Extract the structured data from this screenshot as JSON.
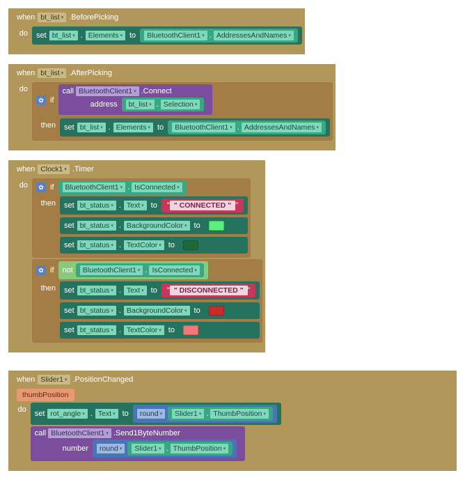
{
  "kw": {
    "when": "when",
    "do": "do",
    "set": "set",
    "to": "to",
    "if": "if",
    "then": "then",
    "call": "call",
    "not": "not"
  },
  "blocks": {
    "beforePicking": {
      "component": "bt_list",
      "event": ".BeforePicking",
      "set": {
        "comp": "bt_list",
        "prop": "Elements",
        "val": {
          "comp": "BluetoothClient1",
          "prop": "AddressesAndNames"
        }
      }
    },
    "afterPicking": {
      "component": "bt_list",
      "event": ".AfterPicking",
      "call": {
        "comp": "BluetoothClient1",
        "method": ".Connect",
        "argName": "address",
        "argVal": {
          "comp": "bt_list",
          "prop": "Selection"
        }
      },
      "thenSet": {
        "comp": "bt_list",
        "prop": "Elements",
        "val": {
          "comp": "BluetoothClient1",
          "prop": "AddressesAndNames"
        }
      }
    },
    "clockTimer": {
      "component": "Clock1",
      "event": ".Timer",
      "ifCond": {
        "comp": "BluetoothClient1",
        "prop": "IsConnected"
      },
      "thenSets": [
        {
          "comp": "bt_status",
          "prop": "Text",
          "string": "\" CONNECTED \""
        },
        {
          "comp": "bt_status",
          "prop": "BackgroundColor",
          "color": "#5af07a"
        },
        {
          "comp": "bt_status",
          "prop": "TextColor",
          "color": "#1e6b3a"
        }
      ],
      "if2Sets": [
        {
          "comp": "bt_status",
          "prop": "Text",
          "string": "\" DISCONNECTED \""
        },
        {
          "comp": "bt_status",
          "prop": "BackgroundColor",
          "color": "#c92a2a"
        },
        {
          "comp": "bt_status",
          "prop": "TextColor",
          "color": "#f07878"
        }
      ]
    },
    "sliderChanged": {
      "component": "Slider1",
      "event": ".PositionChanged",
      "param": "thumbPosition",
      "set": {
        "comp": "rot_angle",
        "prop": "Text",
        "round": "round",
        "val": {
          "comp": "Slider1",
          "prop": "ThumbPosition"
        }
      },
      "call": {
        "comp": "BluetoothClient1",
        "method": ".Send1ByteNumber",
        "argName": "number",
        "round": "round",
        "val": {
          "comp": "Slider1",
          "prop": "ThumbPosition"
        }
      }
    }
  }
}
